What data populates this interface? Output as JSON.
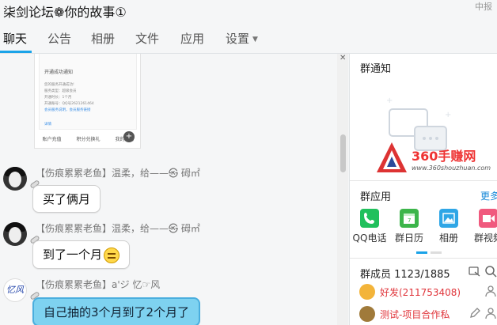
{
  "window": {
    "title": "柒剑论坛❁你的故事①",
    "controls": [
      "中报"
    ]
  },
  "tabs": [
    {
      "label": "聊天",
      "active": true
    },
    {
      "label": "公告",
      "active": false
    },
    {
      "label": "相册",
      "active": false
    },
    {
      "label": "文件",
      "active": false
    },
    {
      "label": "应用",
      "active": false
    },
    {
      "label": "设置",
      "active": false
    }
  ],
  "image_card": {
    "title": "开通成功通知",
    "lines": [
      "您的服务开通成功!",
      "服务类型：超级会员",
      "开通时长：1个月",
      "开通账号：QQ号2621261464",
      "会员服务说明，会员服务链接"
    ],
    "link": "详情",
    "footer": [
      "账户充值",
      "积分兑换礼",
      "我的服务"
    ]
  },
  "messages": [
    {
      "sender": "【伤痕累累老鱼】温柔，给——㉿ 砪㎡",
      "text": "买了俩月"
    },
    {
      "sender": "【伤痕累累老鱼】温柔，给——㉿ 砪㎡",
      "text": "到了一个月"
    },
    {
      "sender": "【伤痕累累老鱼】a'ジ 忆☞风",
      "text": "自己抽的3个月到了2个月了",
      "avatar_text": "忆风"
    }
  ],
  "right": {
    "notice_title": "群通知",
    "watermark_big": "360手赚网",
    "watermark_small": "www.360shouzhuan.com",
    "apps_title": "群应用",
    "apps_more": "更多",
    "apps": [
      {
        "label": "QQ电话",
        "color": "#20c05c"
      },
      {
        "label": "群日历",
        "color": "#3cb54a"
      },
      {
        "label": "相册",
        "color": "#2fa6e6"
      },
      {
        "label": "群视频",
        "color": "#f05a7e"
      }
    ],
    "members_title": "群成员 1123/1885",
    "members": [
      {
        "name": "好发(211753408)",
        "avatar_color": "#f3b43a"
      },
      {
        "name": "测试-项目合作私",
        "avatar_color": "#a07a3a"
      }
    ]
  },
  "colors": {
    "accent": "#1aa3e8",
    "member_name": "#e0353b",
    "blue_bubble": "#7ed2f0"
  }
}
